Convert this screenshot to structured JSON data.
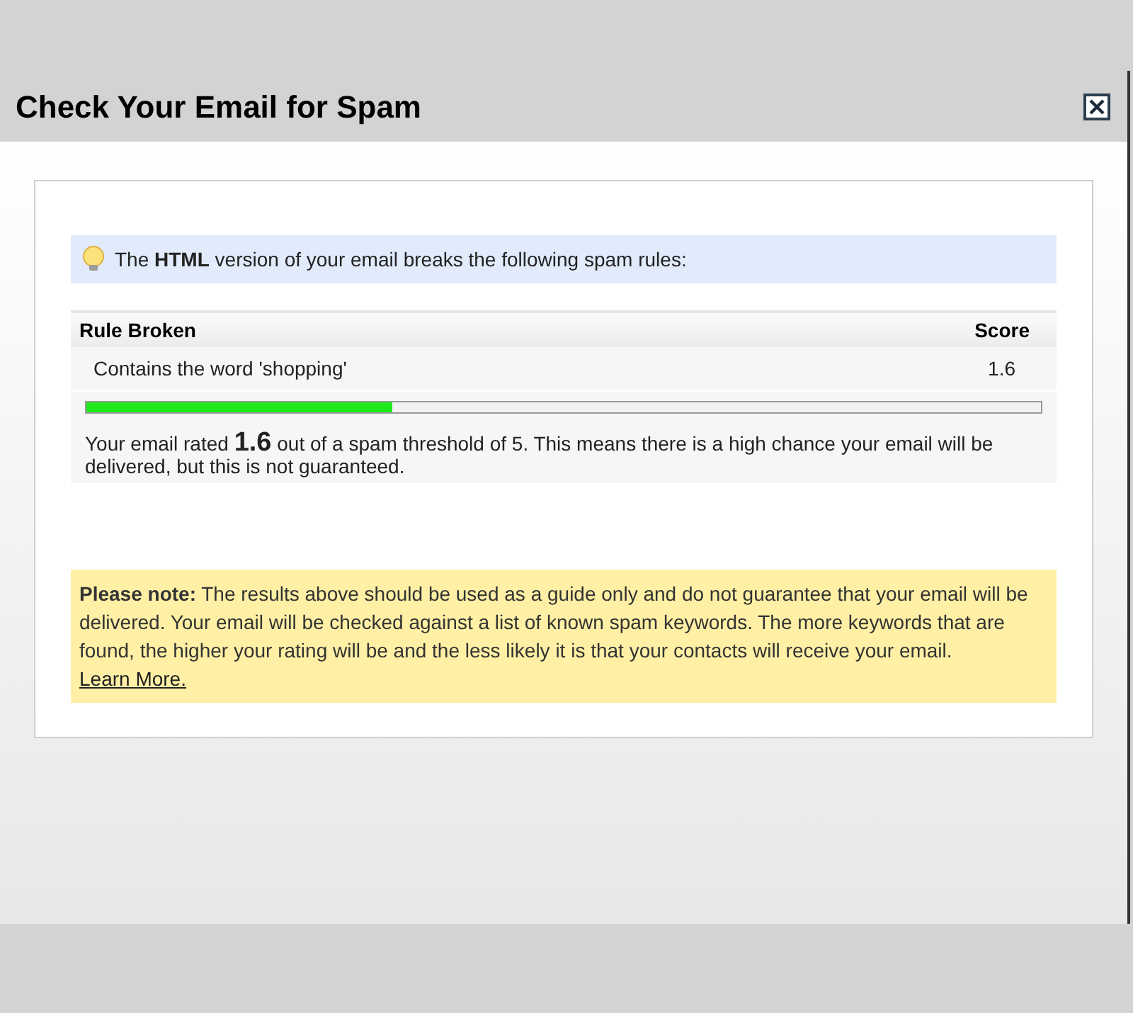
{
  "dialog": {
    "title": "Check Your Email for Spam"
  },
  "notice": {
    "text": "The **HTML** version of your email breaks the following spam rules:"
  },
  "table": {
    "columns": [
      "Rule Broken",
      "Score"
    ],
    "rows": [
      {
        "rule": "Contains the word 'shopping'",
        "score": "1.6"
      }
    ]
  },
  "rating": {
    "level": 0.32,
    "prefix": "Your email rated",
    "score": "1.6",
    "suffix": "out of a spam threshold of 5. This means there is a high chance your email will be delivered, but this is not guaranteed."
  },
  "note": {
    "text": "**Please note:** The results above should be used as a guide only and do not guarantee that your email will be delivered. Your email will be checked against a list of known spam keywords. The more keywords that are found, the higher your rating will be and the less likely it is that your contacts will receive your email.",
    "link": "Learn More."
  }
}
